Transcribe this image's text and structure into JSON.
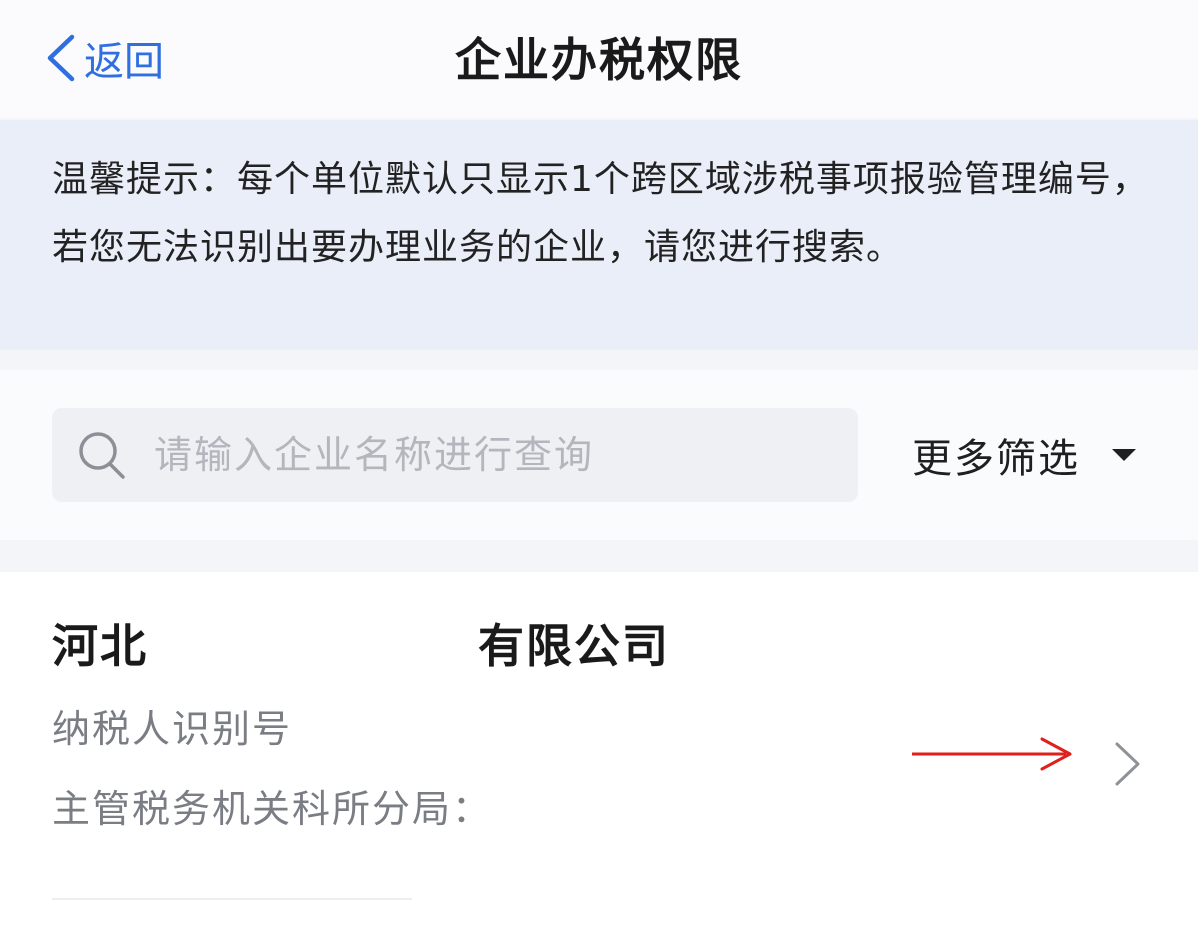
{
  "header": {
    "back_label": "返回",
    "title": "企业办税权限"
  },
  "notice": {
    "text": "温馨提示：每个单位默认只显示1个跨区域涉税事项报验管理编号，若您无法识别出要办理业务的企业，请您进行搜索。"
  },
  "search": {
    "placeholder": "请输入企业名称进行查询",
    "value": ""
  },
  "filter": {
    "label": "更多筛选"
  },
  "company": {
    "name_prefix": "河北",
    "name_suffix": "有限公司",
    "taxpayer_id_label": "纳税人识别号",
    "tax_office_label": "主管税务机关科所分局："
  },
  "colors": {
    "accent": "#2f6fe0",
    "annotation_arrow": "#e0201c",
    "notice_bg": "#e9eef8"
  }
}
